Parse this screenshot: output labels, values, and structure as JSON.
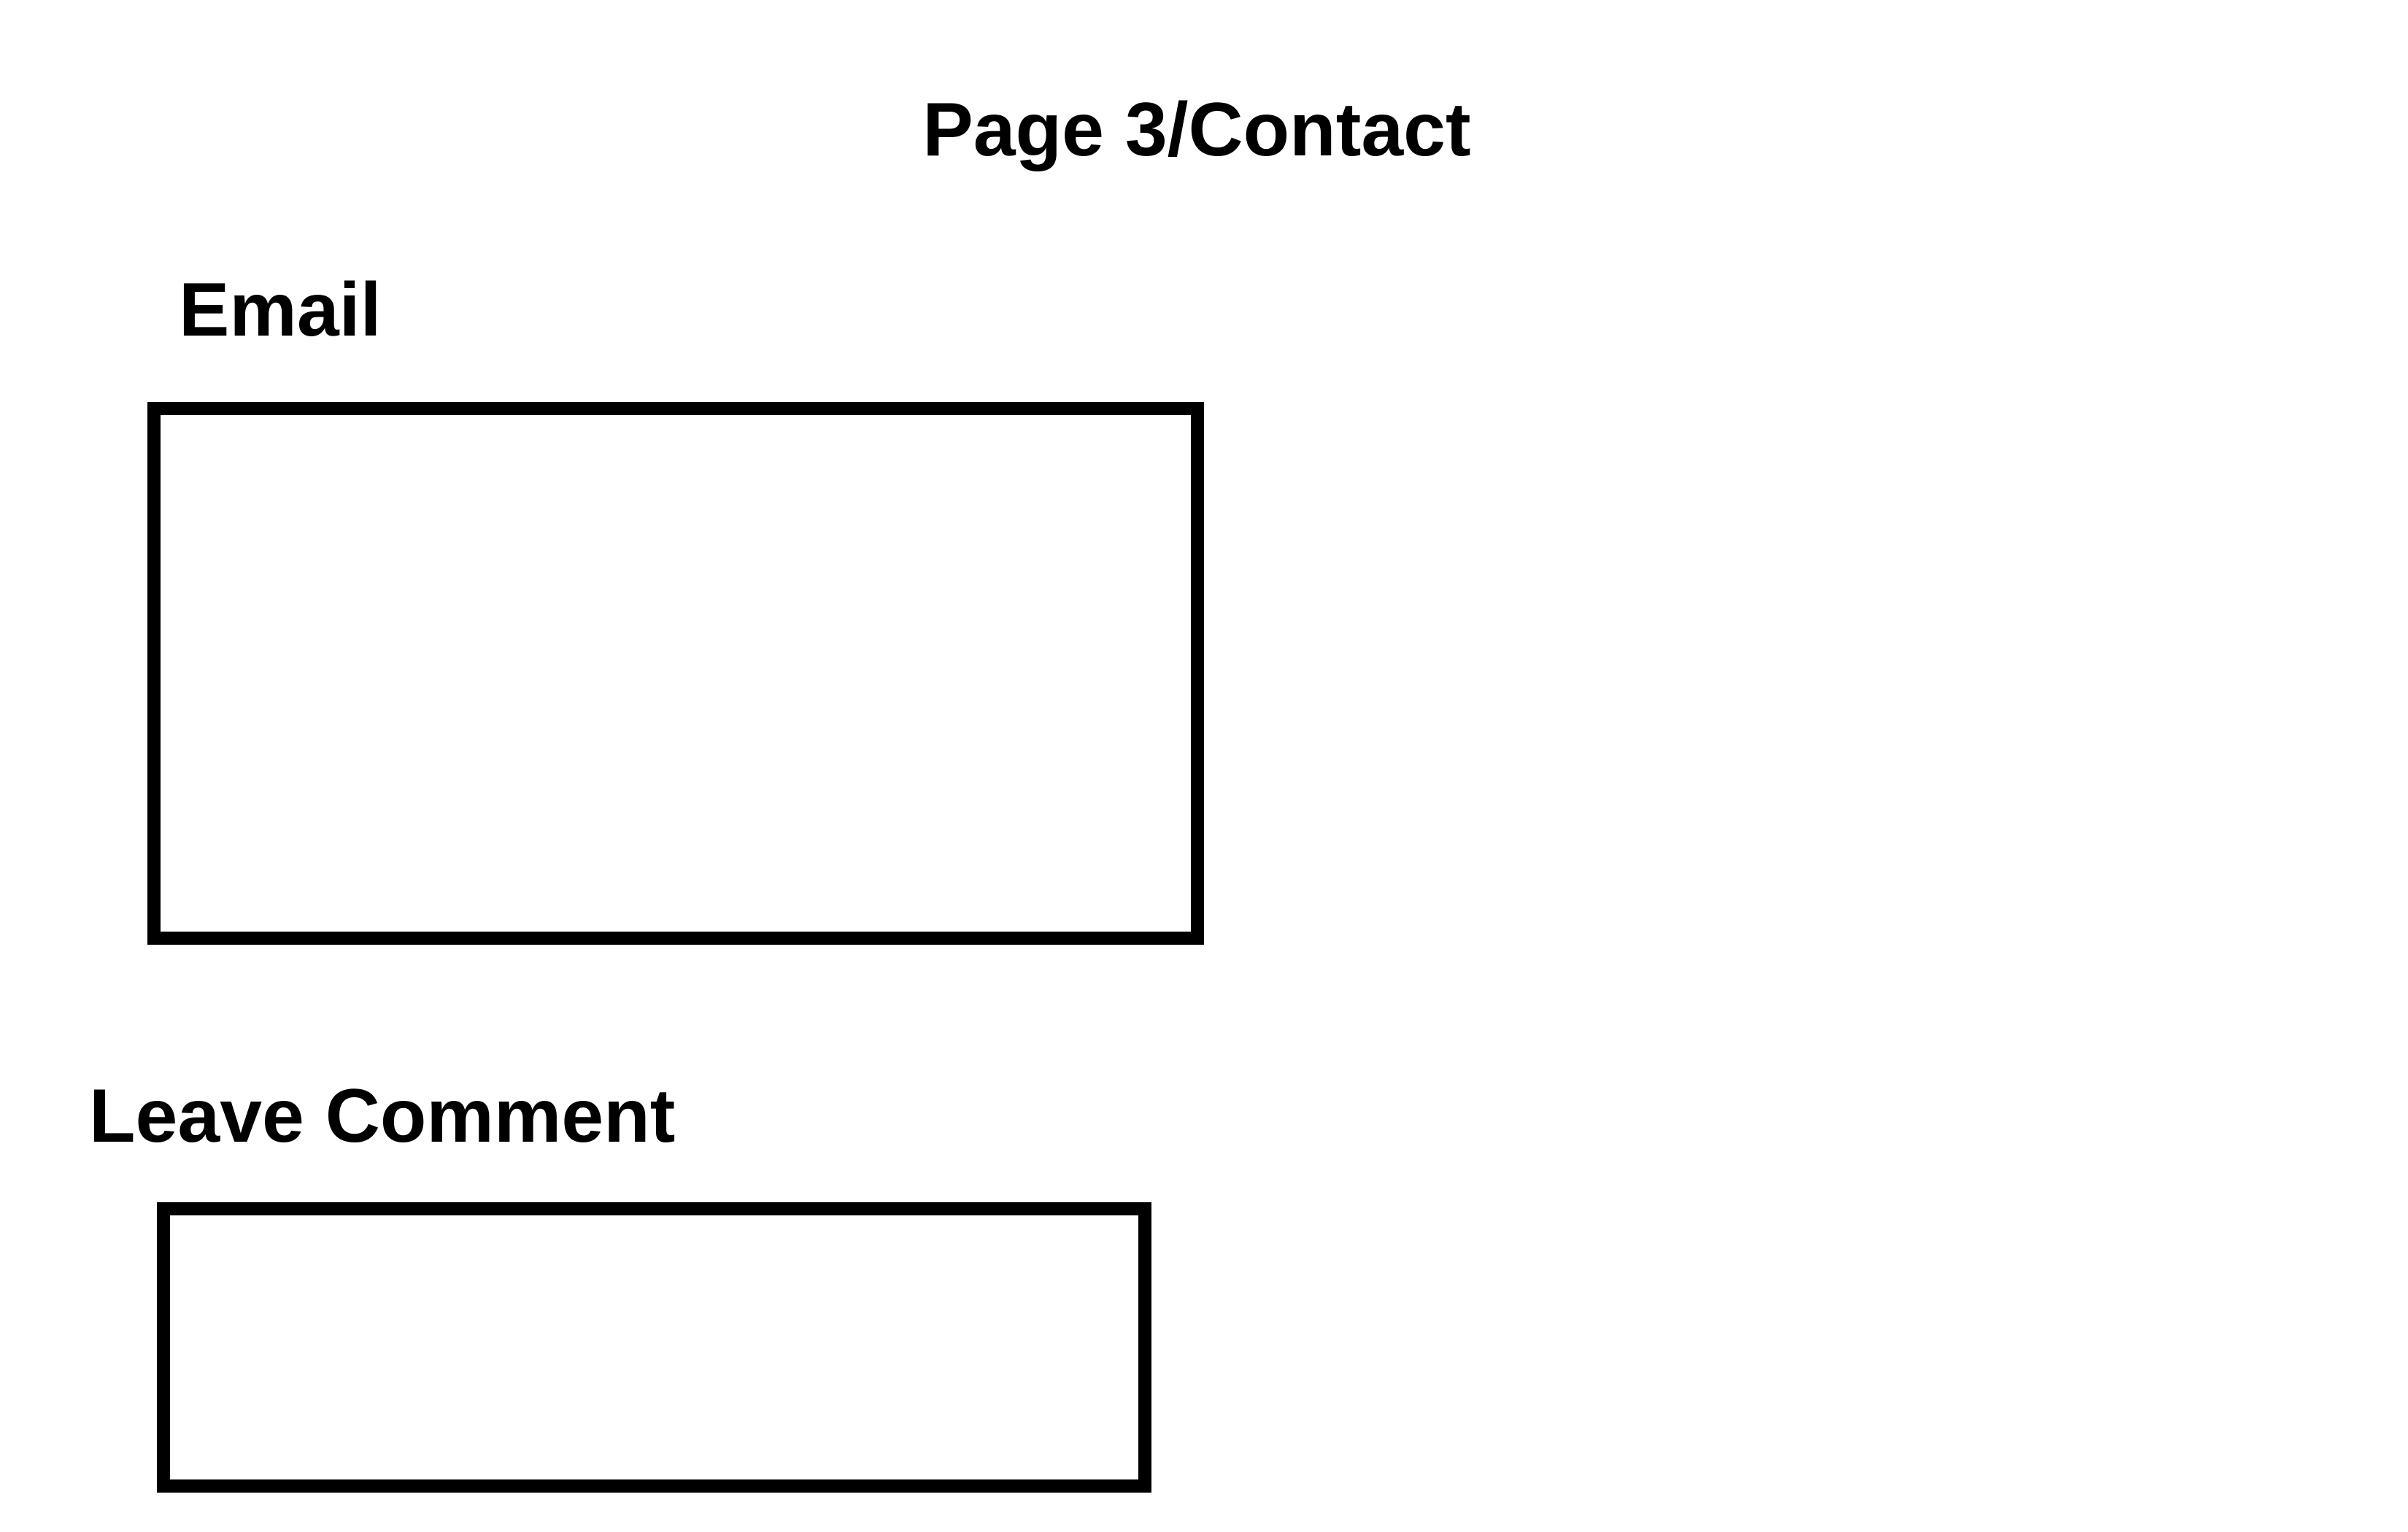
{
  "page": {
    "title": "Page 3/Contact"
  },
  "form": {
    "email": {
      "label": "Email",
      "value": "",
      "placeholder": ""
    },
    "comment": {
      "label": "Leave Comment",
      "value": "",
      "placeholder": ""
    }
  },
  "colors": {
    "background": "#ffffff",
    "text": "#000000",
    "border": "#000000"
  }
}
